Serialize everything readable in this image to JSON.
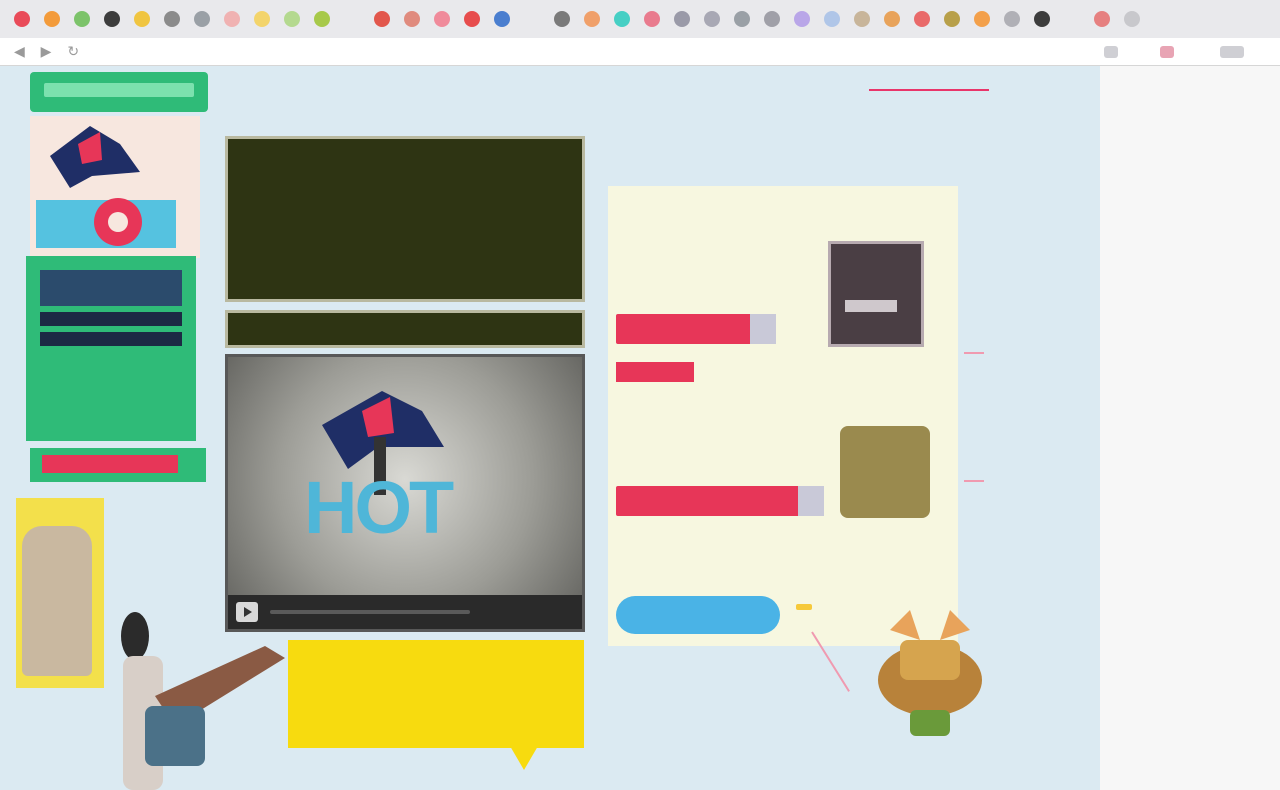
{
  "browser": {
    "url": "",
    "favicon_colors": [
      "#e94b59",
      "#f39b3b",
      "#7cc36a",
      "#3d3d3d",
      "#f0c541",
      "#8b8b8b",
      "#9aa0a6",
      "#f0b2b2",
      "#f3d46b",
      "#b4d98f",
      "#a7c94a",
      "#e9e9ec",
      "#e2574c",
      "#e08b7e",
      "#f08b9b",
      "#e74d4d",
      "#4a7ecf",
      "#e9e9ec",
      "#7a7a7a",
      "#f0a06a",
      "#46cfc4",
      "#e97b8e",
      "#9a9aa8",
      "#a8a8b4",
      "#9aa0a6",
      "#a0a0a8",
      "#b9a6e8",
      "#b0c6e8",
      "#c8b59a",
      "#e8a35b",
      "#e96a6a",
      "#b8a04a",
      "#f3a04b",
      "#b0b0b6",
      "#3d3d3d",
      "#e9e9ec",
      "#e68080",
      "#c8c8cc"
    ],
    "tab_title": ""
  },
  "nav": {
    "items": [
      "",
      "",
      "",
      "",
      "",
      "",
      ""
    ]
  },
  "left": {
    "promo_lines": [
      "",
      ""
    ],
    "signup_label": ""
  },
  "feature": {
    "title": "",
    "body": "",
    "links": [
      "",
      "",
      ""
    ]
  },
  "video": {
    "logo_word": "HOT",
    "logo_sub": "",
    "time": ""
  },
  "promo": {
    "title": "",
    "text": ""
  },
  "right": {
    "links": "",
    "sub": "",
    "panel_head": "",
    "panel_head2": "",
    "product1": {
      "desc": "",
      "buy_label": "",
      "sale_label": "",
      "price_note": ""
    },
    "product2": {
      "desc": "",
      "buy_label": "",
      "price_note": ""
    },
    "blue_button": "",
    "badge": ""
  }
}
